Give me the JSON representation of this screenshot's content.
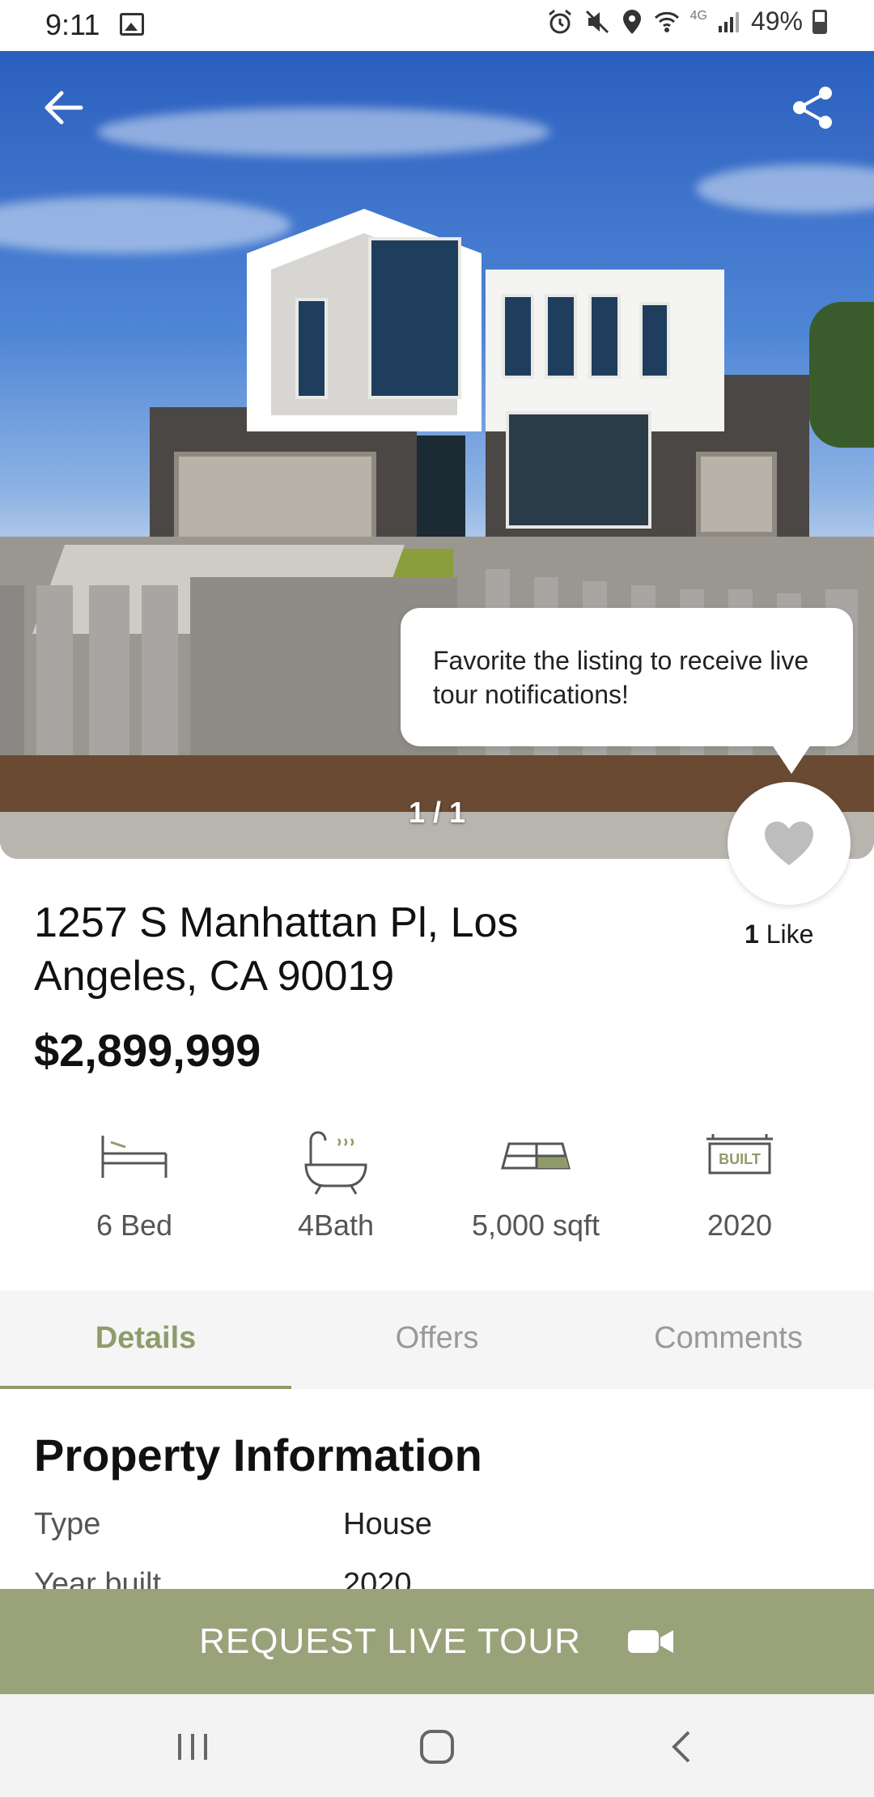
{
  "status_bar": {
    "time": "9:11",
    "network": "4G",
    "battery": "49%",
    "icons": [
      "image-icon",
      "alarm-icon",
      "mute-icon",
      "location-icon",
      "wifi-icon",
      "signal-icon",
      "battery-icon"
    ]
  },
  "hero": {
    "image_counter": "1 / 1",
    "tooltip": "Favorite the listing to receive live tour notifications!"
  },
  "listing": {
    "address": "1257 S Manhattan Pl, Los Angeles, CA 90019",
    "price": "$2,899,999",
    "likes_count": "1",
    "likes_label": "Like"
  },
  "features": [
    {
      "icon": "bed-icon",
      "label": "6 Bed"
    },
    {
      "icon": "bathtub-icon",
      "label": "4Bath"
    },
    {
      "icon": "floorplan-icon",
      "label": "5,000 sqft"
    },
    {
      "icon": "built-sign-icon",
      "label": "2020",
      "sign_text": "BUILT"
    }
  ],
  "tabs": [
    {
      "label": "Details",
      "active": true
    },
    {
      "label": "Offers",
      "active": false
    },
    {
      "label": "Comments",
      "active": false
    }
  ],
  "property_info": {
    "title": "Property Information",
    "rows": [
      {
        "key": "Type",
        "value": "House"
      },
      {
        "key": "Year built",
        "value": "2020"
      }
    ]
  },
  "cta": {
    "label": "REQUEST LIVE TOUR",
    "icon": "video-camera-icon"
  },
  "colors": {
    "accent": "#8f9c6a",
    "cta_background": "#9aa27a",
    "heart": "#bdbdbd"
  }
}
